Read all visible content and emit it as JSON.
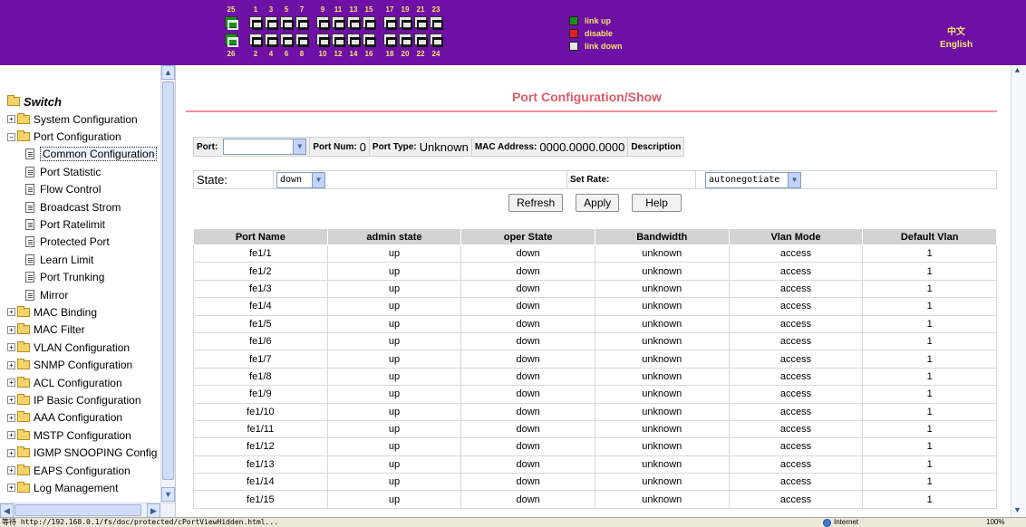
{
  "header": {
    "ports_top": [
      {
        "num": "25",
        "state": "up"
      },
      {
        "num": "1",
        "state": "down"
      },
      {
        "num": "3",
        "state": "down"
      },
      {
        "num": "5",
        "state": "down"
      },
      {
        "num": "7",
        "state": "down"
      },
      {
        "num": "9",
        "state": "down"
      },
      {
        "num": "11",
        "state": "down"
      },
      {
        "num": "13",
        "state": "down"
      },
      {
        "num": "15",
        "state": "down"
      },
      {
        "num": "17",
        "state": "down"
      },
      {
        "num": "19",
        "state": "down"
      },
      {
        "num": "21",
        "state": "down"
      },
      {
        "num": "23",
        "state": "down"
      }
    ],
    "ports_bottom": [
      {
        "num": "26",
        "state": "up"
      },
      {
        "num": "2",
        "state": "down"
      },
      {
        "num": "4",
        "state": "down"
      },
      {
        "num": "6",
        "state": "down"
      },
      {
        "num": "8",
        "state": "down"
      },
      {
        "num": "10",
        "state": "down"
      },
      {
        "num": "12",
        "state": "down"
      },
      {
        "num": "14",
        "state": "down"
      },
      {
        "num": "16",
        "state": "down"
      },
      {
        "num": "18",
        "state": "down"
      },
      {
        "num": "20",
        "state": "down"
      },
      {
        "num": "22",
        "state": "down"
      },
      {
        "num": "24",
        "state": "down"
      }
    ],
    "legend": [
      {
        "label": "link up",
        "color": "#1b8f1b"
      },
      {
        "label": "disable",
        "color": "#e02020"
      },
      {
        "label": "link down",
        "color": "#e6e6e6"
      }
    ],
    "lang_cn": "中文",
    "lang_en": "English"
  },
  "sidebar": {
    "root": "Switch",
    "items": [
      {
        "label": "System Configuration",
        "type": "folder",
        "expanded": false
      },
      {
        "label": "Port Configuration",
        "type": "folder",
        "expanded": true
      },
      {
        "label": "Common Configuration",
        "type": "page",
        "selected": true
      },
      {
        "label": "Port Statistic",
        "type": "page"
      },
      {
        "label": "Flow Control",
        "type": "page"
      },
      {
        "label": "Broadcast Strom",
        "type": "page"
      },
      {
        "label": "Port Ratelimit",
        "type": "page"
      },
      {
        "label": "Protected Port",
        "type": "page"
      },
      {
        "label": "Learn Limit",
        "type": "page"
      },
      {
        "label": "Port Trunking",
        "type": "page"
      },
      {
        "label": "Mirror",
        "type": "page"
      },
      {
        "label": "MAC Binding",
        "type": "folder",
        "expanded": false
      },
      {
        "label": "MAC Filter",
        "type": "folder",
        "expanded": false
      },
      {
        "label": "VLAN Configuration",
        "type": "folder",
        "expanded": false
      },
      {
        "label": "SNMP Configuration",
        "type": "folder",
        "expanded": false
      },
      {
        "label": "ACL Configuration",
        "type": "folder",
        "expanded": false
      },
      {
        "label": "IP Basic Configuration",
        "type": "folder",
        "expanded": false
      },
      {
        "label": "AAA Configuration",
        "type": "folder",
        "expanded": false
      },
      {
        "label": "MSTP Configuration",
        "type": "folder",
        "expanded": false
      },
      {
        "label": "IGMP SNOOPING Config",
        "type": "folder",
        "expanded": false
      },
      {
        "label": "EAPS Configuration",
        "type": "folder",
        "expanded": false
      },
      {
        "label": "Log Management",
        "type": "folder",
        "expanded": false
      }
    ]
  },
  "main": {
    "title": "Port Configuration/Show",
    "port_label": "Port:",
    "port_value": "",
    "port_num_label": "Port Num:",
    "port_num_value": "0",
    "port_type_label": "Port Type:",
    "port_type_value": "Unknown",
    "mac_label": "MAC Address:",
    "mac_value": "0000.0000.0000",
    "desc_label": "Description",
    "state_label": "State:",
    "state_value": "down",
    "rate_label": "Set Rate:",
    "rate_value": "autonegotiate",
    "btn_refresh": "Refresh",
    "btn_apply": "Apply",
    "btn_help": "Help",
    "columns": [
      "Port Name",
      "admin state",
      "oper State",
      "Bandwidth",
      "Vlan Mode",
      "Default Vlan"
    ],
    "rows": [
      [
        "fe1/1",
        "up",
        "down",
        "unknown",
        "access",
        "1"
      ],
      [
        "fe1/2",
        "up",
        "down",
        "unknown",
        "access",
        "1"
      ],
      [
        "fe1/3",
        "up",
        "down",
        "unknown",
        "access",
        "1"
      ],
      [
        "fe1/4",
        "up",
        "down",
        "unknown",
        "access",
        "1"
      ],
      [
        "fe1/5",
        "up",
        "down",
        "unknown",
        "access",
        "1"
      ],
      [
        "fe1/6",
        "up",
        "down",
        "unknown",
        "access",
        "1"
      ],
      [
        "fe1/7",
        "up",
        "down",
        "unknown",
        "access",
        "1"
      ],
      [
        "fe1/8",
        "up",
        "down",
        "unknown",
        "access",
        "1"
      ],
      [
        "fe1/9",
        "up",
        "down",
        "unknown",
        "access",
        "1"
      ],
      [
        "fe1/10",
        "up",
        "down",
        "unknown",
        "access",
        "1"
      ],
      [
        "fe1/11",
        "up",
        "down",
        "unknown",
        "access",
        "1"
      ],
      [
        "fe1/12",
        "up",
        "down",
        "unknown",
        "access",
        "1"
      ],
      [
        "fe1/13",
        "up",
        "down",
        "unknown",
        "access",
        "1"
      ],
      [
        "fe1/14",
        "up",
        "down",
        "unknown",
        "access",
        "1"
      ],
      [
        "fe1/15",
        "up",
        "down",
        "unknown",
        "access",
        "1"
      ]
    ]
  },
  "statusbar": {
    "text": "等待 http://192.168.0.1/fs/doc/protected/cPortViewHidden.html...",
    "zone": "Internet",
    "zoom": "100%"
  }
}
